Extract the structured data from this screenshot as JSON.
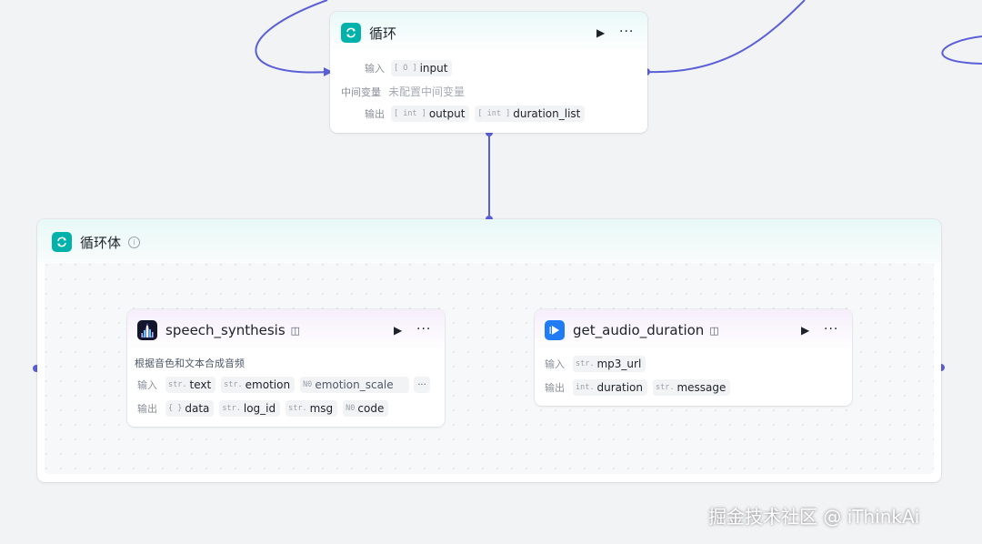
{
  "loop_node": {
    "title": "循环",
    "input_label": "输入",
    "input_param": {
      "type": "[ O ]",
      "name": "input"
    },
    "mid_label": "中间变量",
    "mid_value": "未配置中间变量",
    "output_label": "输出",
    "output_params": [
      {
        "type": "[ int ]",
        "name": "output"
      },
      {
        "type": "[ int ]",
        "name": "duration_list"
      }
    ]
  },
  "loop_body": {
    "title": "循环体"
  },
  "speech_node": {
    "title": "speech_synthesis",
    "description": "根据音色和文本合成音频",
    "input_label": "输入",
    "inputs": [
      {
        "type": "str.",
        "name": "text"
      },
      {
        "type": "str.",
        "name": "emotion"
      },
      {
        "type": "N0",
        "name": "emotion_scale"
      }
    ],
    "more_inputs": "···",
    "output_label": "输出",
    "outputs": [
      {
        "type": "{ }",
        "name": "data"
      },
      {
        "type": "str.",
        "name": "log_id"
      },
      {
        "type": "str.",
        "name": "msg"
      },
      {
        "type": "N0",
        "name": "code"
      }
    ]
  },
  "audio_node": {
    "title": "get_audio_duration",
    "input_label": "输入",
    "inputs": [
      {
        "type": "str.",
        "name": "mp3_url"
      }
    ],
    "output_label": "输出",
    "outputs": [
      {
        "type": "int.",
        "name": "duration"
      },
      {
        "type": "str.",
        "name": "message"
      }
    ]
  },
  "watermark": "掘金技术社区 @ iThinkAi",
  "colors": {
    "edge": "#5b5fd6",
    "loop_icon": "#00b2a9",
    "audio_icon": "#1f7cf5"
  }
}
